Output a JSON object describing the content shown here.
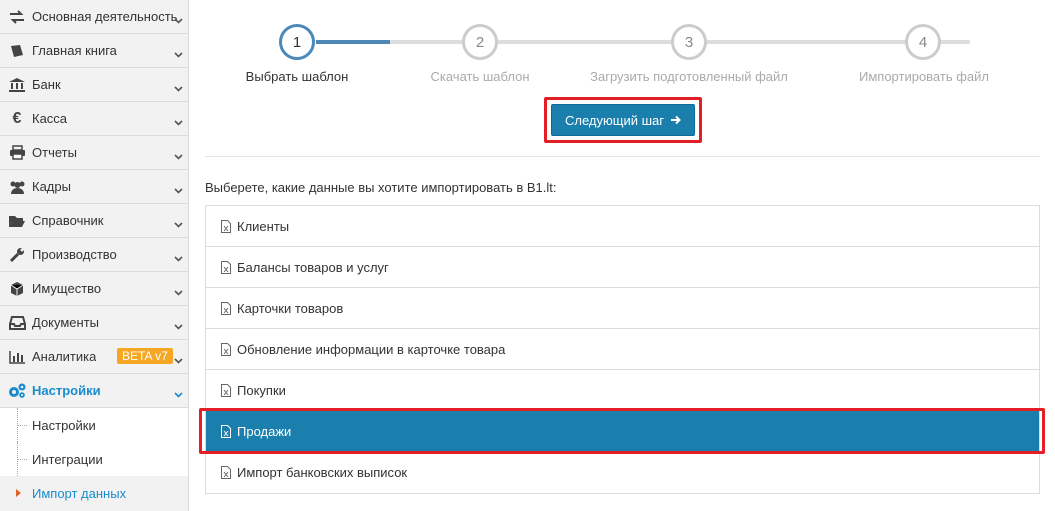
{
  "sidebar": {
    "items": [
      {
        "label": "Основная деятельность",
        "icon": "exchange-icon"
      },
      {
        "label": "Главная книга",
        "icon": "book-icon"
      },
      {
        "label": "Банк",
        "icon": "bank-icon"
      },
      {
        "label": "Касса",
        "icon": "euro-icon"
      },
      {
        "label": "Отчеты",
        "icon": "printer-icon"
      },
      {
        "label": "Кадры",
        "icon": "users-icon"
      },
      {
        "label": "Справочник",
        "icon": "folder-open-icon"
      },
      {
        "label": "Производство",
        "icon": "wrench-icon"
      },
      {
        "label": "Имущество",
        "icon": "cube-icon"
      },
      {
        "label": "Документы",
        "icon": "inbox-icon"
      },
      {
        "label": "Аналитика",
        "icon": "bar-chart-icon",
        "badge": "BETA v7"
      },
      {
        "label": "Настройки",
        "icon": "cogs-icon"
      }
    ],
    "subitems": [
      {
        "label": "Настройки"
      },
      {
        "label": "Интеграции"
      },
      {
        "label": "Импорт данных"
      }
    ]
  },
  "wizard": {
    "steps": [
      {
        "number": "1",
        "label": "Выбрать шаблон"
      },
      {
        "number": "2",
        "label": "Скачать шаблон"
      },
      {
        "number": "3",
        "label": "Загрузить подготовленный файл"
      },
      {
        "number": "4",
        "label": "Импортировать файл"
      }
    ],
    "next_label": "Следующий шаг"
  },
  "prompt": "Выберете, какие данные вы хотите импортировать в B1.lt:",
  "import_options": [
    "Клиенты",
    "Балансы товаров и услуг",
    "Карточки товаров",
    "Обновление информации в карточке товара",
    "Покупки",
    "Продажи",
    "Импорт банковских выписок"
  ],
  "colors": {
    "accent": "#1a7fad",
    "highlight": "#e31e24",
    "badge": "#f5a623",
    "active_link": "#1a8ccd"
  }
}
